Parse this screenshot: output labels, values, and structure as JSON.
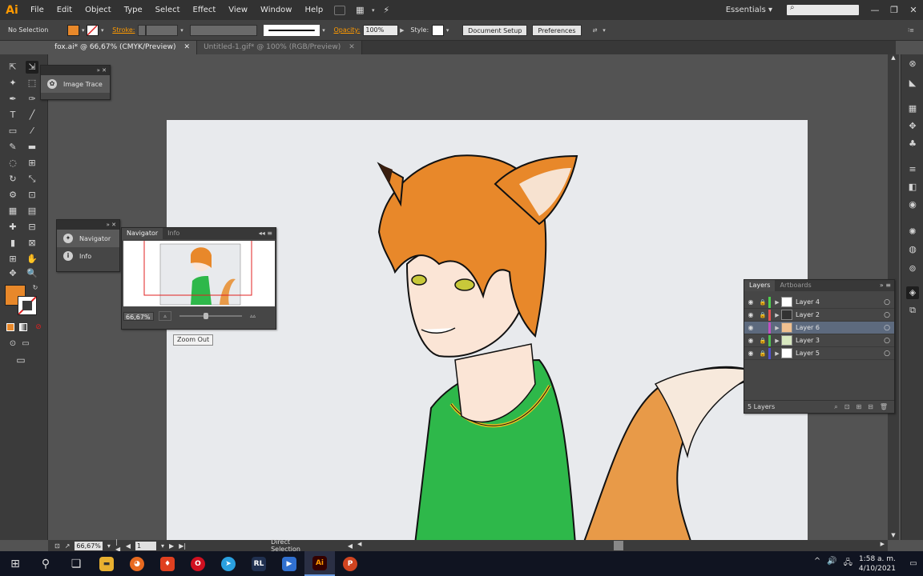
{
  "app": {
    "logo": "Ai"
  },
  "menu": [
    "File",
    "Edit",
    "Object",
    "Type",
    "Select",
    "Effect",
    "View",
    "Window",
    "Help"
  ],
  "menubar_right": {
    "workspace": "Essentials",
    "workspace_dd": "▾",
    "search_glyph": "⌕",
    "minimize": "—",
    "maximize": "❐",
    "close": "✕",
    "arrange": "▦",
    "arrange_dd": "▾",
    "gpu": "⚡"
  },
  "control_bar": {
    "selection": "No Selection",
    "stroke_label": "Stroke:",
    "opacity_label": "Opacity:",
    "opacity_value": "100%",
    "style_label": "Style:",
    "doc_setup": "Document Setup",
    "preferences": "Preferences",
    "fill_color": "#e8882a",
    "dd": "▾",
    "play": "▶",
    "arrange": "⇄",
    "more": "⁝≡"
  },
  "doc_tabs": [
    {
      "title": "fox.ai* @ 66,67% (CMYK/Preview)",
      "close": "✕"
    },
    {
      "title": "Untitled-1.gif* @ 100% (RGB/Preview)",
      "close": "✕"
    }
  ],
  "tools": [
    "⇱",
    "⇲",
    "✦",
    "⬚",
    "✒",
    "✑",
    "T",
    "╱",
    "▭",
    "⁄",
    "✎",
    "▬",
    "◌",
    "⊞",
    "↻",
    "⤡",
    "⚙",
    "⊡",
    "▦",
    "▤",
    "✚",
    "⊟",
    "▮",
    "⊠",
    "⊞",
    "✋",
    "✥",
    "🔍"
  ],
  "tool_misc": {
    "swap": "↻",
    "fill_none": "⁄",
    "none_swatch": "⊘",
    "default": "▭",
    "draw_mode": "⊙",
    "screen": "▭",
    "screen_mode": "▭"
  },
  "right_dock": [
    "⊗",
    "◣",
    "▦",
    "✥",
    "♣",
    "≡",
    "◧",
    "◉",
    "✺",
    "◍",
    "⊚",
    "◈",
    "⧉"
  ],
  "image_trace_panel": {
    "label": "Image Trace",
    "head": "»  ✕",
    "icon": "✿"
  },
  "collapsed_panel": {
    "items": [
      "Navigator",
      "Info"
    ],
    "head": "»  ✕",
    "icons": [
      "✦",
      "i"
    ]
  },
  "navigator_panel": {
    "tabs": [
      "Navigator",
      "Info"
    ],
    "tab_menu": "◂◂  ≡",
    "zoom": "66,67%",
    "zoom_out_icon": "▵",
    "zoom_in_icon": "▵▵"
  },
  "tooltip": "Zoom Out",
  "layers_panel": {
    "tabs": [
      "Layers",
      "Artboards"
    ],
    "tab_menu": "»  ≡",
    "eye": "◉",
    "lock": "🔒",
    "expand": "▶",
    "target": "○",
    "layers": [
      {
        "name": "Layer 4",
        "color": "#4fcf4f",
        "locked": true
      },
      {
        "name": "Layer 2",
        "color": "#e85050",
        "locked": true
      },
      {
        "name": "Layer 6",
        "color": "#c050c0",
        "locked": false
      },
      {
        "name": "Layer 3",
        "color": "#50c050",
        "locked": true
      },
      {
        "name": "Layer 5",
        "color": "#5050d0",
        "locked": true
      }
    ],
    "count": "5 Layers",
    "footer_icons": [
      "⌕",
      "⊡",
      "⊞",
      "⊟",
      "🗑"
    ]
  },
  "status_bar": {
    "zoom": "66,67%",
    "page": "1",
    "tool": "Direct Selection",
    "dd": "▾",
    "prev": "◀",
    "next": "▶",
    "first": "|◀",
    "last": "▶|",
    "save": "⊡",
    "share": "↗"
  },
  "taskbar": {
    "start": "⊞",
    "search": "⚲",
    "task_view": "❏",
    "apps": [
      {
        "name": "File Explorer",
        "glyph": "▬",
        "color": "#e8b030"
      },
      {
        "name": "Firefox",
        "glyph": "◕",
        "color": "#e86a20"
      },
      {
        "name": "Brave",
        "glyph": "♦",
        "color": "#e04020"
      },
      {
        "name": "Opera",
        "glyph": "O",
        "color": "#d01020"
      },
      {
        "name": "Telegram",
        "glyph": "➤",
        "color": "#2aa0e0"
      },
      {
        "name": "RL",
        "glyph": "RL",
        "color": "#203050"
      },
      {
        "name": "Media",
        "glyph": "▶",
        "color": "#3070d0"
      },
      {
        "name": "Illustrator",
        "glyph": "Ai",
        "color": "#330000"
      },
      {
        "name": "PowerPoint",
        "glyph": "P",
        "color": "#d04420"
      }
    ],
    "tray": [
      "^",
      "🔊",
      "🖧"
    ],
    "time": "1:58 a. m.",
    "date": "4/10/2021",
    "notify": "▭"
  }
}
